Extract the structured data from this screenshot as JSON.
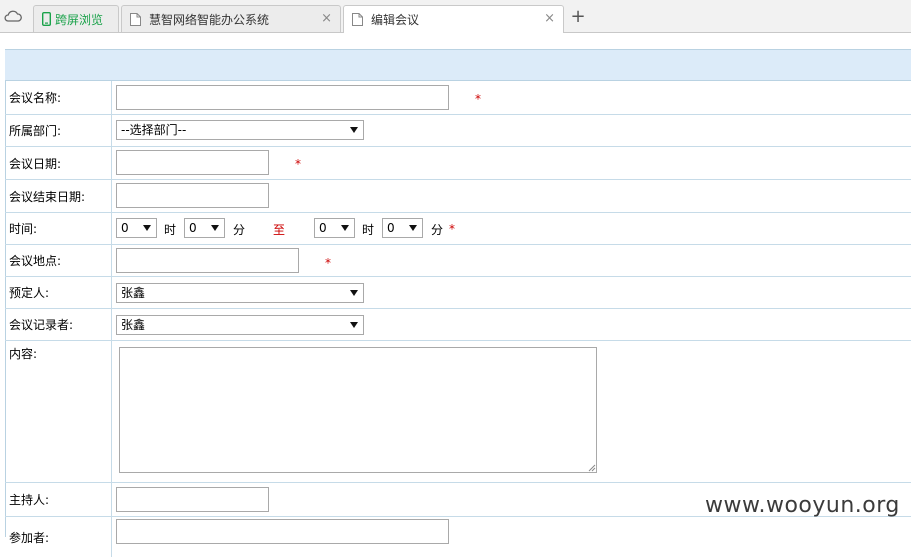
{
  "tabs": [
    {
      "label": "跨屏浏览",
      "icon": "phone-icon"
    },
    {
      "label": "慧智网络智能办公系统",
      "icon": "document-icon"
    },
    {
      "label": "编辑会议",
      "icon": "document-icon"
    }
  ],
  "tab_close": "×",
  "new_tab": "+",
  "form": {
    "name_label": "会议名称:",
    "dept_label": "所属部门:",
    "dept_value": "--选择部门--",
    "date_label": "会议日期:",
    "end_date_label": "会议结束日期:",
    "time_label": "时间:",
    "start_hour": "0",
    "start_minute": "0",
    "end_hour": "0",
    "end_minute": "0",
    "hour_unit": "时",
    "minute_unit": "分",
    "to_text": "至",
    "location_label": "会议地点:",
    "booker_label": "预定人:",
    "booker_value": "张鑫",
    "recorder_label": "会议记录者:",
    "recorder_value": "张鑫",
    "content_label": "内容:",
    "host_label": "主持人:",
    "attendees_label": "参加者:",
    "required_mark": "*"
  },
  "watermark": "www.wooyun.org",
  "colors": {
    "header_band": "#dcebf9",
    "required": "#cc0000",
    "green_tab": "#1aa24a"
  }
}
